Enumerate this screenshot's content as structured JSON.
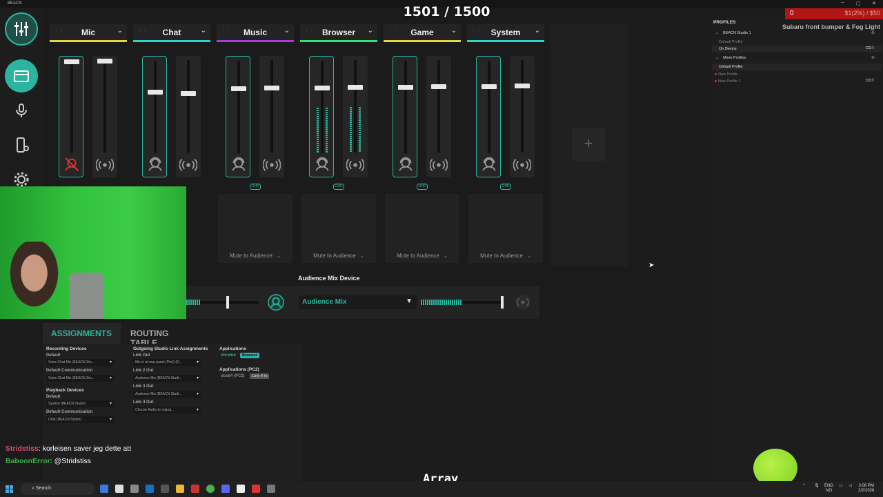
{
  "window": {
    "title": "BEACN",
    "controls": [
      "─",
      "▢",
      "✕"
    ]
  },
  "channels": [
    {
      "name": "Mic",
      "color": "#e8d43b",
      "left_muted": true,
      "has_link": false,
      "mute_label": ""
    },
    {
      "name": "Chat",
      "color": "#2bd5c9",
      "left_muted": false,
      "has_link": false,
      "mute_label": ""
    },
    {
      "name": "Music",
      "color": "#a23ee0",
      "left_muted": false,
      "has_link": true,
      "mute_label": "Mute to Audience"
    },
    {
      "name": "Browser",
      "color": "#34e07a",
      "left_muted": false,
      "has_link": true,
      "mute_label": "Mute to Audience"
    },
    {
      "name": "Game",
      "color": "#e8d43b",
      "left_muted": false,
      "has_link": true,
      "mute_label": "Mute to Audience"
    },
    {
      "name": "System",
      "color": "#2bd5c9",
      "left_muted": false,
      "has_link": true,
      "mute_label": "Mute to Audience"
    }
  ],
  "link_badge": "GHD",
  "audience": {
    "label": "Audience Mix Device",
    "selected": "Audience Mix",
    "chevron": "▼"
  },
  "tabs": {
    "assignments": "ASSIGNMENTS",
    "routing": "ROUTING TABLE"
  },
  "assignments": {
    "recording_title": "Recording Devices",
    "rec_default_label": "Default",
    "rec_default_value": "Voice Chat Mic (BEACN Stu...",
    "rec_comm_label": "Default Communication",
    "rec_comm_value": "Voice Chat Mic (BEACN Stu...",
    "playback_title": "Playback Devices",
    "pb_default_label": "Default",
    "pb_default_value": "System (BEACN Studio)",
    "pb_comm_label": "Default Communication",
    "pb_comm_value": "Chat (BEACN Studio)",
    "outgoing_title": "Outgoing Studio Link Assignments",
    "link1_label": "Link Out",
    "link1_value": "Mic in at rear panel (Pink) (R...",
    "link2_label": "Link 2 Out",
    "link2_value": "Audience Mix (BEACN Studi...",
    "link3_label": "Link 3 Out",
    "link3_value": "Audience Mix (BEACN Studi...",
    "link4_label": "Link 4 Out",
    "link4_value": "Choose Audio to output...",
    "apps_title": "Applications",
    "app1_name": "chrome",
    "app1_tag": "Browser",
    "apps_pc2_title": "Applications (PC2)",
    "app2_name": "obs64 (PC2)",
    "app2_tag": "Link 4 In"
  },
  "profiles": {
    "title": "PROFILES",
    "device": "BEACN Studio 1",
    "default_profile": "Default Profile",
    "on_device": "On Device",
    "mixer_profiles": "Mixer Profiles",
    "mixer_default": "Default Profile",
    "new_profile": "New Profile",
    "new_profile_1": "New Profile 1"
  },
  "overlay": {
    "counter": "1501 / 1500",
    "goal_current": "0",
    "goal_target": "$1(2%) / $50",
    "goal_name": "Subaru front bumper & Fog Light",
    "brand": "Array"
  },
  "chat": [
    {
      "user": "Stridstiss",
      "text": "korleisen saver jeg dette att"
    },
    {
      "user": "BaboonError",
      "text": "@Stridstiss"
    }
  ],
  "taskbar": {
    "search": "Search",
    "lang1": "ENG",
    "lang2": "NO",
    "time": "3:06 PM",
    "date": "2/2/2026"
  }
}
